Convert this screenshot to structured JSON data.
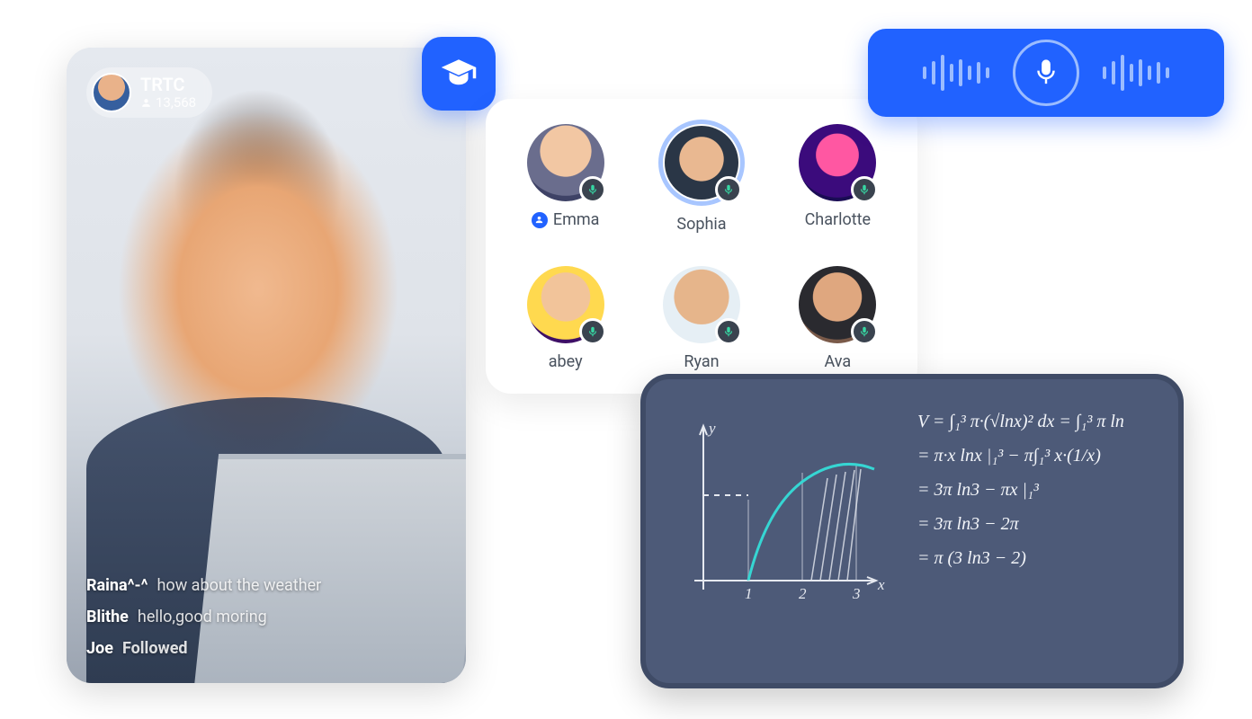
{
  "host": {
    "name": "TRTC",
    "viewer_count": "13,568"
  },
  "chat": [
    {
      "user": "Raina^-^",
      "msg": "how about the weather",
      "kind": "msg"
    },
    {
      "user": "Blithe",
      "msg": "hello,good moring",
      "kind": "msg"
    },
    {
      "user": "Joe",
      "msg": "Followed",
      "kind": "follow"
    }
  ],
  "participants": [
    {
      "name": "Emma",
      "is_host": true,
      "highlighted": false
    },
    {
      "name": "Sophia",
      "is_host": false,
      "highlighted": true
    },
    {
      "name": "Charlotte",
      "is_host": false,
      "highlighted": false
    },
    {
      "name": "abey",
      "is_host": false,
      "highlighted": false
    },
    {
      "name": "Ryan",
      "is_host": false,
      "highlighted": false
    },
    {
      "name": "Ava",
      "is_host": false,
      "highlighted": false
    }
  ],
  "board": {
    "ylabel": "y",
    "xlabel": "x",
    "ticks": [
      "1",
      "2",
      "3"
    ],
    "equations": [
      "V = ∫₁³ π·(√lnx)² dx = ∫₁³ π ln",
      "= π·x lnx |₁³ − π∫₁³ x·(1/x)",
      "= 3π ln3 − πx |₁³",
      "= 3π ln3 − 2π",
      "= π (3 ln3 − 2)"
    ]
  },
  "colors": {
    "brand": "#2162ff",
    "board": "#4d5a78",
    "curve": "#36d6d3"
  }
}
